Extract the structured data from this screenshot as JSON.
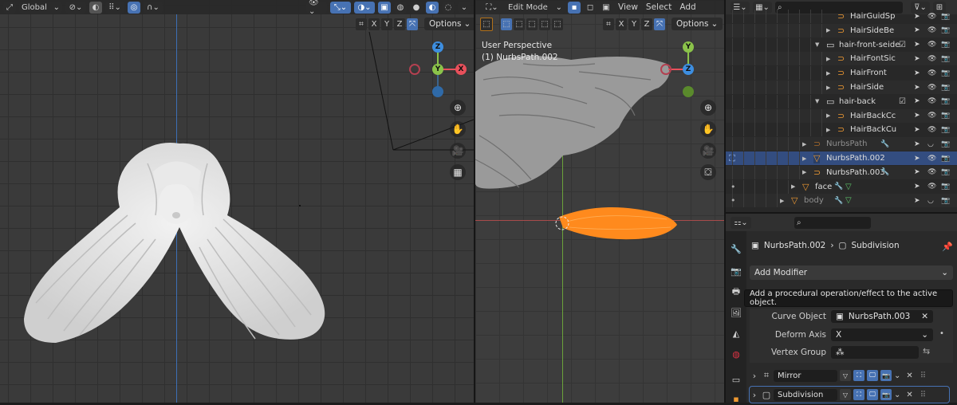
{
  "left_viewport": {
    "transform_orientation": "Global",
    "options_label": "Options",
    "axes": [
      "X",
      "Y",
      "Z"
    ]
  },
  "mid_viewport": {
    "mode": "Edit Mode",
    "menus": [
      "View",
      "Select",
      "Add"
    ],
    "options_label": "Options",
    "axes": [
      "X",
      "Y",
      "Z"
    ],
    "perspective_label": "User Perspective",
    "active_object_label": "(1) NurbsPath.002"
  },
  "gizmo": {
    "x": "X",
    "y": "Y",
    "z": "Z"
  },
  "outliner": {
    "rows": [
      {
        "name": "HairGuidSp"
      },
      {
        "name": "HairSideBe"
      },
      {
        "name": "hair-front-seide"
      },
      {
        "name": "HairFontSic"
      },
      {
        "name": "HairFront"
      },
      {
        "name": "HairSide"
      },
      {
        "name": "hair-back"
      },
      {
        "name": "HairBackCc"
      },
      {
        "name": "HairBackCu"
      },
      {
        "name": "NurbsPath"
      },
      {
        "name": "NurbsPath.002"
      },
      {
        "name": "NurbsPath.003"
      },
      {
        "name": "face"
      },
      {
        "name": "body"
      }
    ]
  },
  "properties": {
    "breadcrumb_object": "NurbsPath.002",
    "breadcrumb_modifier": "Subdivision",
    "add_modifier_label": "Add Modifier",
    "tooltip": "Add a procedural operation/effect to the active object.",
    "curve_object_label": "Curve Object",
    "curve_object_value": "NurbsPath.003",
    "deform_axis_label": "Deform Axis",
    "deform_axis_value": "X",
    "vertex_group_label": "Vertex Group",
    "modifiers": [
      {
        "name": "Mirror"
      },
      {
        "name": "Subdivision"
      }
    ]
  },
  "colors": {
    "accent": "#4772b3",
    "selection": "#ff8a1d",
    "axis_x": "#e8505b",
    "axis_y": "#8bc34a",
    "axis_z": "#3d8ee0"
  }
}
